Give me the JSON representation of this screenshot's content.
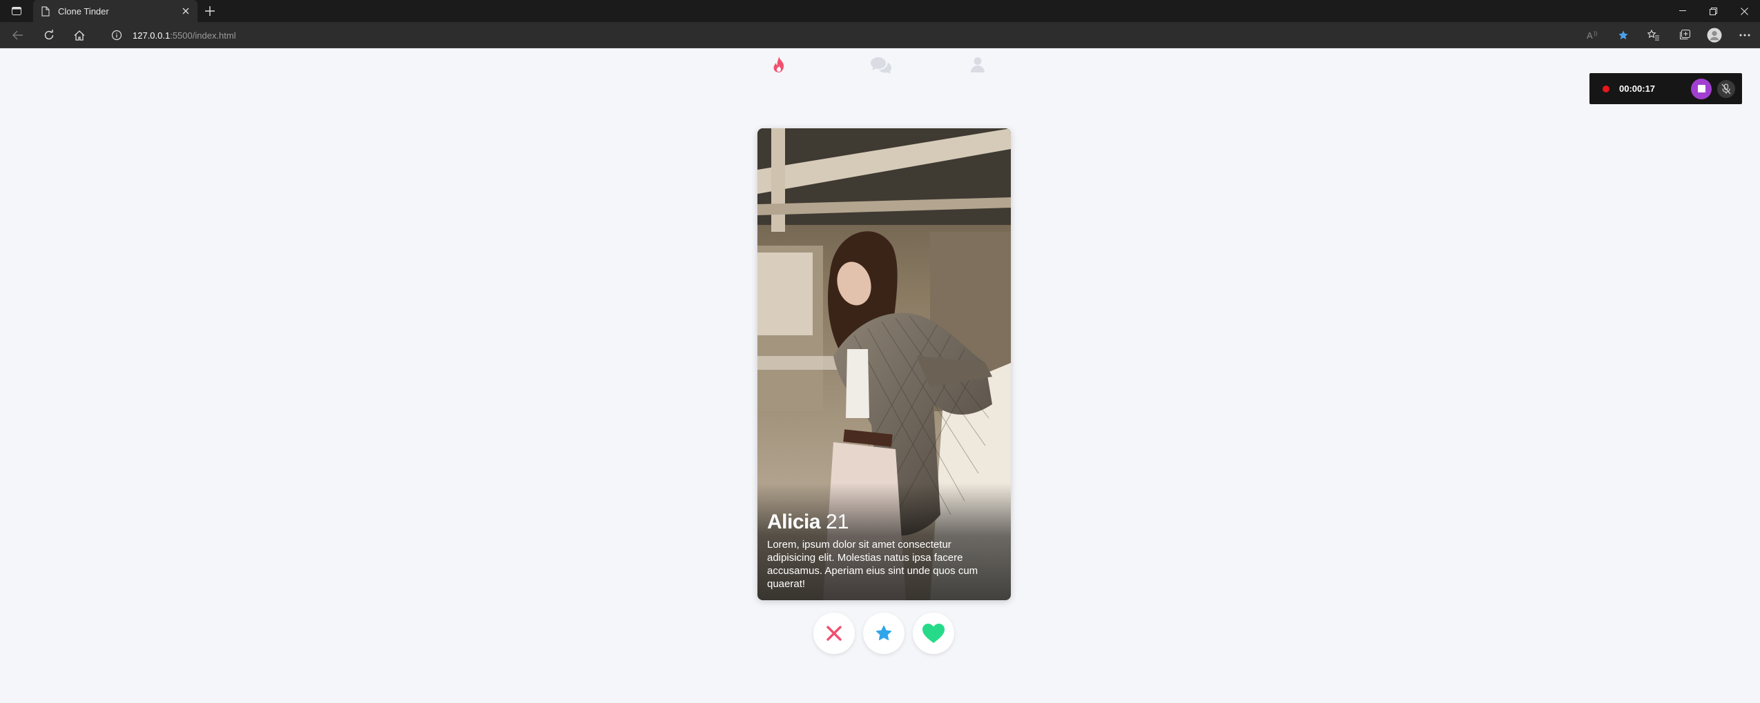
{
  "browser": {
    "tab_title": "Clone Tinder",
    "url_host": "127.0.0.1",
    "url_rest": ":5500/index.html"
  },
  "nav": {
    "icons": [
      "flame-icon",
      "chat-bubbles-icon",
      "user-icon"
    ],
    "active_color": "#f0506e",
    "inactive_color": "#d9dce3"
  },
  "card": {
    "name": "Alicia",
    "age": "21",
    "bio": "Lorem, ipsum dolor sit amet consectetur adipisicing elit. Molestias natus ipsa facere accusamus. Aperiam eius sint unde quos cum quaerat!"
  },
  "actions": {
    "icons": [
      "close-icon",
      "star-icon",
      "heart-icon"
    ],
    "colors": {
      "dislike": "#f0506e",
      "superlike": "#2fa5ea",
      "like": "#27da89"
    }
  },
  "recorder": {
    "time": "00:00:17"
  }
}
